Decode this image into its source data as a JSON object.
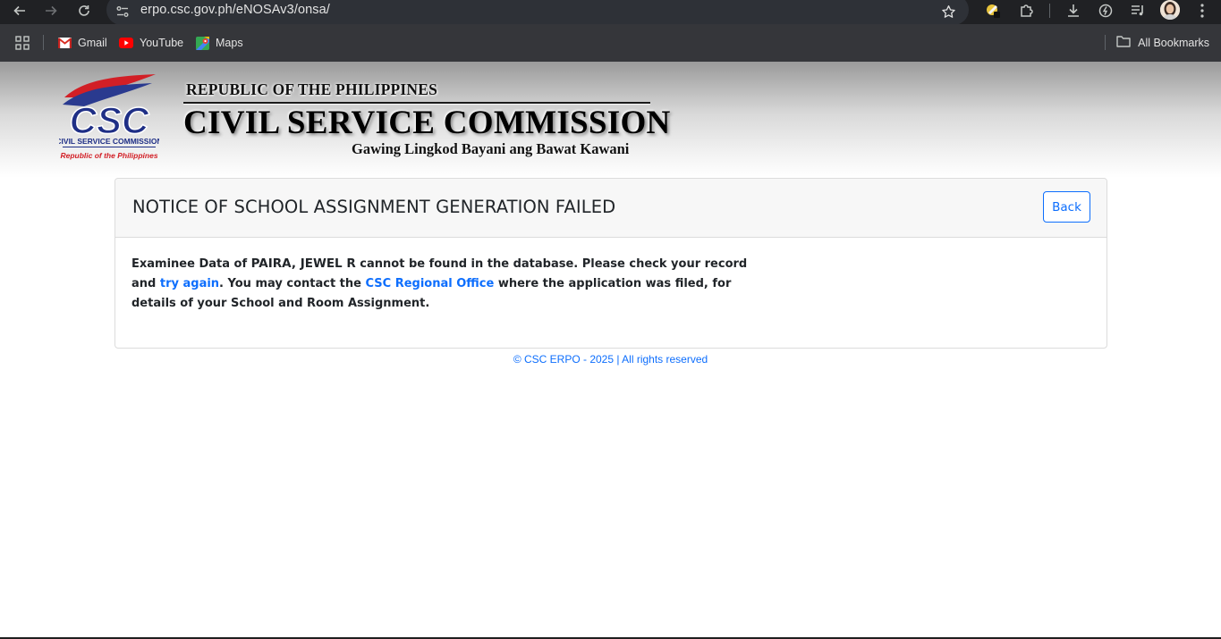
{
  "browser": {
    "url": "erpo.csc.gov.ph/eNOSAv3/onsa/",
    "bookmarks": [
      {
        "label": "Gmail",
        "icon": "gmail-icon"
      },
      {
        "label": "YouTube",
        "icon": "youtube-icon"
      },
      {
        "label": "Maps",
        "icon": "maps-icon"
      }
    ],
    "all_bookmarks_label": "All Bookmarks"
  },
  "banner": {
    "logo_text": "CSC",
    "logo_caption1": "CIVIL SERVICE COMMISSION",
    "logo_caption2": "Republic of the Philippines",
    "republic": "REPUBLIC OF THE PHILIPPINES",
    "agency": "CIVIL SERVICE COMMISSION",
    "tagline": "Gawing Lingkod Bayani ang Bawat Kawani"
  },
  "card": {
    "title": "NOTICE OF SCHOOL ASSIGNMENT GENERATION FAILED",
    "back_label": "Back",
    "msg_prefix": "Examinee Data of ",
    "examinee_name": "PAIRA, JEWEL R",
    "msg_mid1": " cannot be found in the database. Please check your record and ",
    "link_try_again": "try again",
    "msg_mid2": ". You may contact the ",
    "link_regional_office": "CSC Regional Office",
    "msg_suffix": " where the application was filed, for details of your School and Room Assignment."
  },
  "footer": {
    "text": "© CSC ERPO - 2025 | All rights reserved"
  },
  "colors": {
    "link": "#0d6efd",
    "chrome_dark": "#202124",
    "bookmarks_bar": "#35363a"
  }
}
